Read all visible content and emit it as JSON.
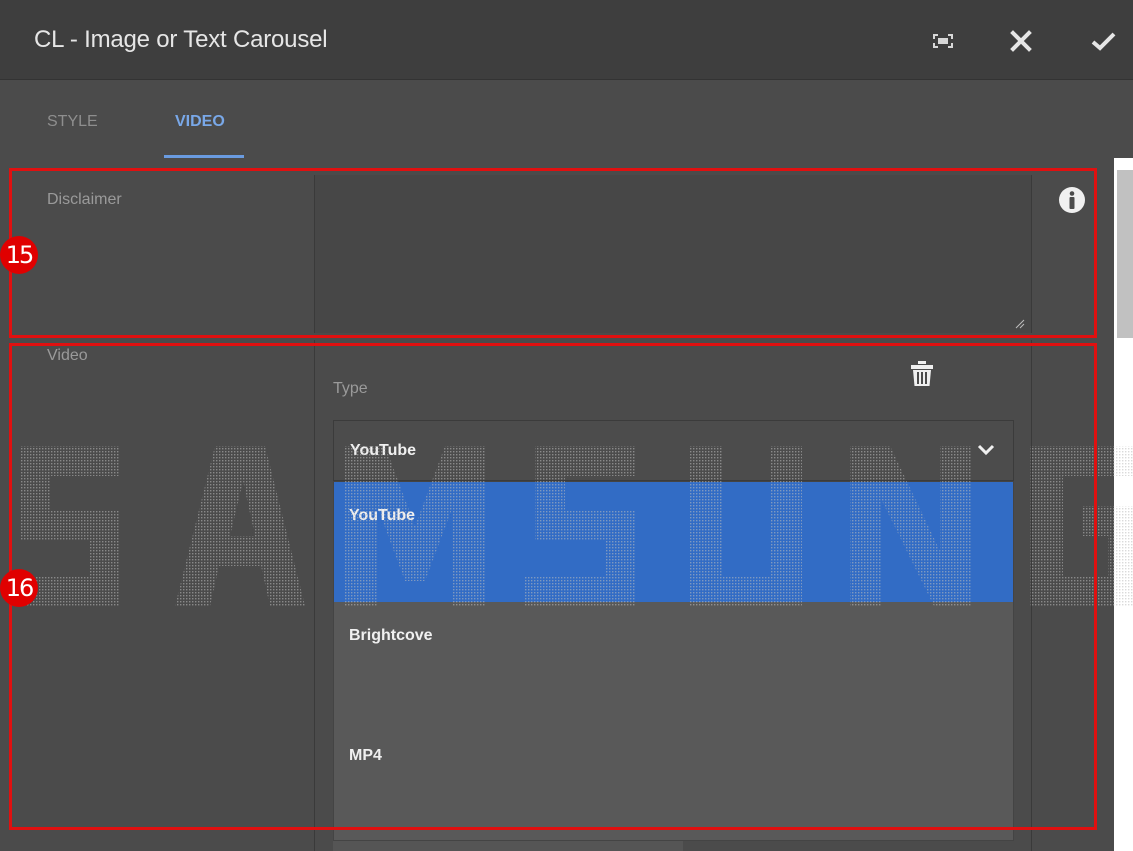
{
  "dialog": {
    "title": "CL - Image or Text Carousel",
    "header_icons": [
      "fullscreen-icon",
      "close-icon",
      "check-icon"
    ]
  },
  "tabs": [
    {
      "label": "STYLE",
      "active": false
    },
    {
      "label": "VIDEO",
      "active": true
    }
  ],
  "fields": {
    "disclaimer": {
      "label": "Disclaimer",
      "value": ""
    },
    "video": {
      "label": "Video",
      "type_label": "Type",
      "selected": "YouTube",
      "options": [
        "YouTube",
        "Brightcove",
        "MP4"
      ]
    }
  },
  "annotations": [
    {
      "number": "15"
    },
    {
      "number": "16"
    }
  ],
  "colors": {
    "accent": "#326cc5",
    "active_tab": "#79a8e8",
    "annotation": "#e01010"
  }
}
